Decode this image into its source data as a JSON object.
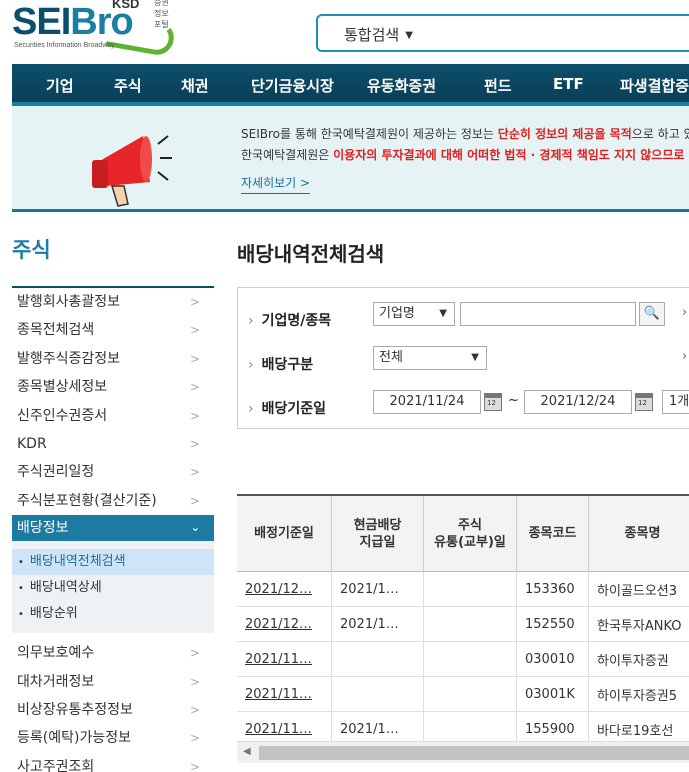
{
  "logo": {
    "ksd": "KSD",
    "ksd_sub": "증권정보포털",
    "sei": "SEI",
    "bro": "Bro",
    "tagline": "Securities Information Broadway"
  },
  "search": {
    "scope": "통합검색"
  },
  "nav": [
    "기업",
    "주식",
    "채권",
    "단기금융시장",
    "유동화증권",
    "펀드",
    "ETF",
    "파생결합증"
  ],
  "notice": {
    "l1_a": "SEIBro를 통해 한국예탁결제원이 제공하는 정보는 ",
    "l1_red": "단순히 정보의 제공을 목적",
    "l1_b": "으로 하고 있으",
    "l2_a": "한국예탁결제원은 ",
    "l2_red": "이용자의 투자결과에 대해 어떠한 법적 · 경제적 책임도 지지 않으므로",
    "more": "자세히보기 >"
  },
  "sidebar": {
    "title": "주식",
    "items_top": [
      "발행회사총괄정보",
      "종목전체검색",
      "발행주식증감정보",
      "종목별상세정보",
      "신주인수권증서",
      "KDR",
      "주식권리일정",
      "주식분포현황(결산기준)"
    ],
    "active": "배당정보",
    "sub": [
      "배당내역전체검색",
      "배당내역상세",
      "배당순위"
    ],
    "items_bottom": [
      "의무보호예수",
      "대차거래정보",
      "비상장유통추정정보",
      "등록(예탁)가능정보",
      "사고주권조회"
    ]
  },
  "page": {
    "title": "배당내역전체검색"
  },
  "filter": {
    "company_label": "기업명/종목",
    "company_select": "기업명",
    "company_value": "",
    "search_icon": "search-icon",
    "div_label": "배당구분",
    "div_select": "전체",
    "date_label": "배당기준일",
    "date_from": "2021/11/24",
    "date_to": "2021/12/24",
    "tilde": "~",
    "period": "1개"
  },
  "table": {
    "headers": [
      "배정기준일",
      "현금배당\n지급일",
      "주식\n유통(교부)일",
      "종목코드",
      "종목명"
    ],
    "rows": [
      [
        "2021/12…",
        "2021/1…",
        "",
        "153360",
        "하이골드오션3"
      ],
      [
        "2021/12…",
        "2021/1…",
        "",
        "152550",
        "한국투자ANKO"
      ],
      [
        "2021/11…",
        "",
        "",
        "030010",
        "하이투자증권"
      ],
      [
        "2021/11…",
        "",
        "",
        "03001K",
        "하이투자증권5"
      ],
      [
        "2021/11…",
        "2021/1…",
        "",
        "155900",
        "바다로19호선"
      ]
    ]
  },
  "colors": {
    "navy": "#0c4f6b",
    "accent": "#1a7ea3",
    "red": "#e02020",
    "green": "#5cb531"
  }
}
